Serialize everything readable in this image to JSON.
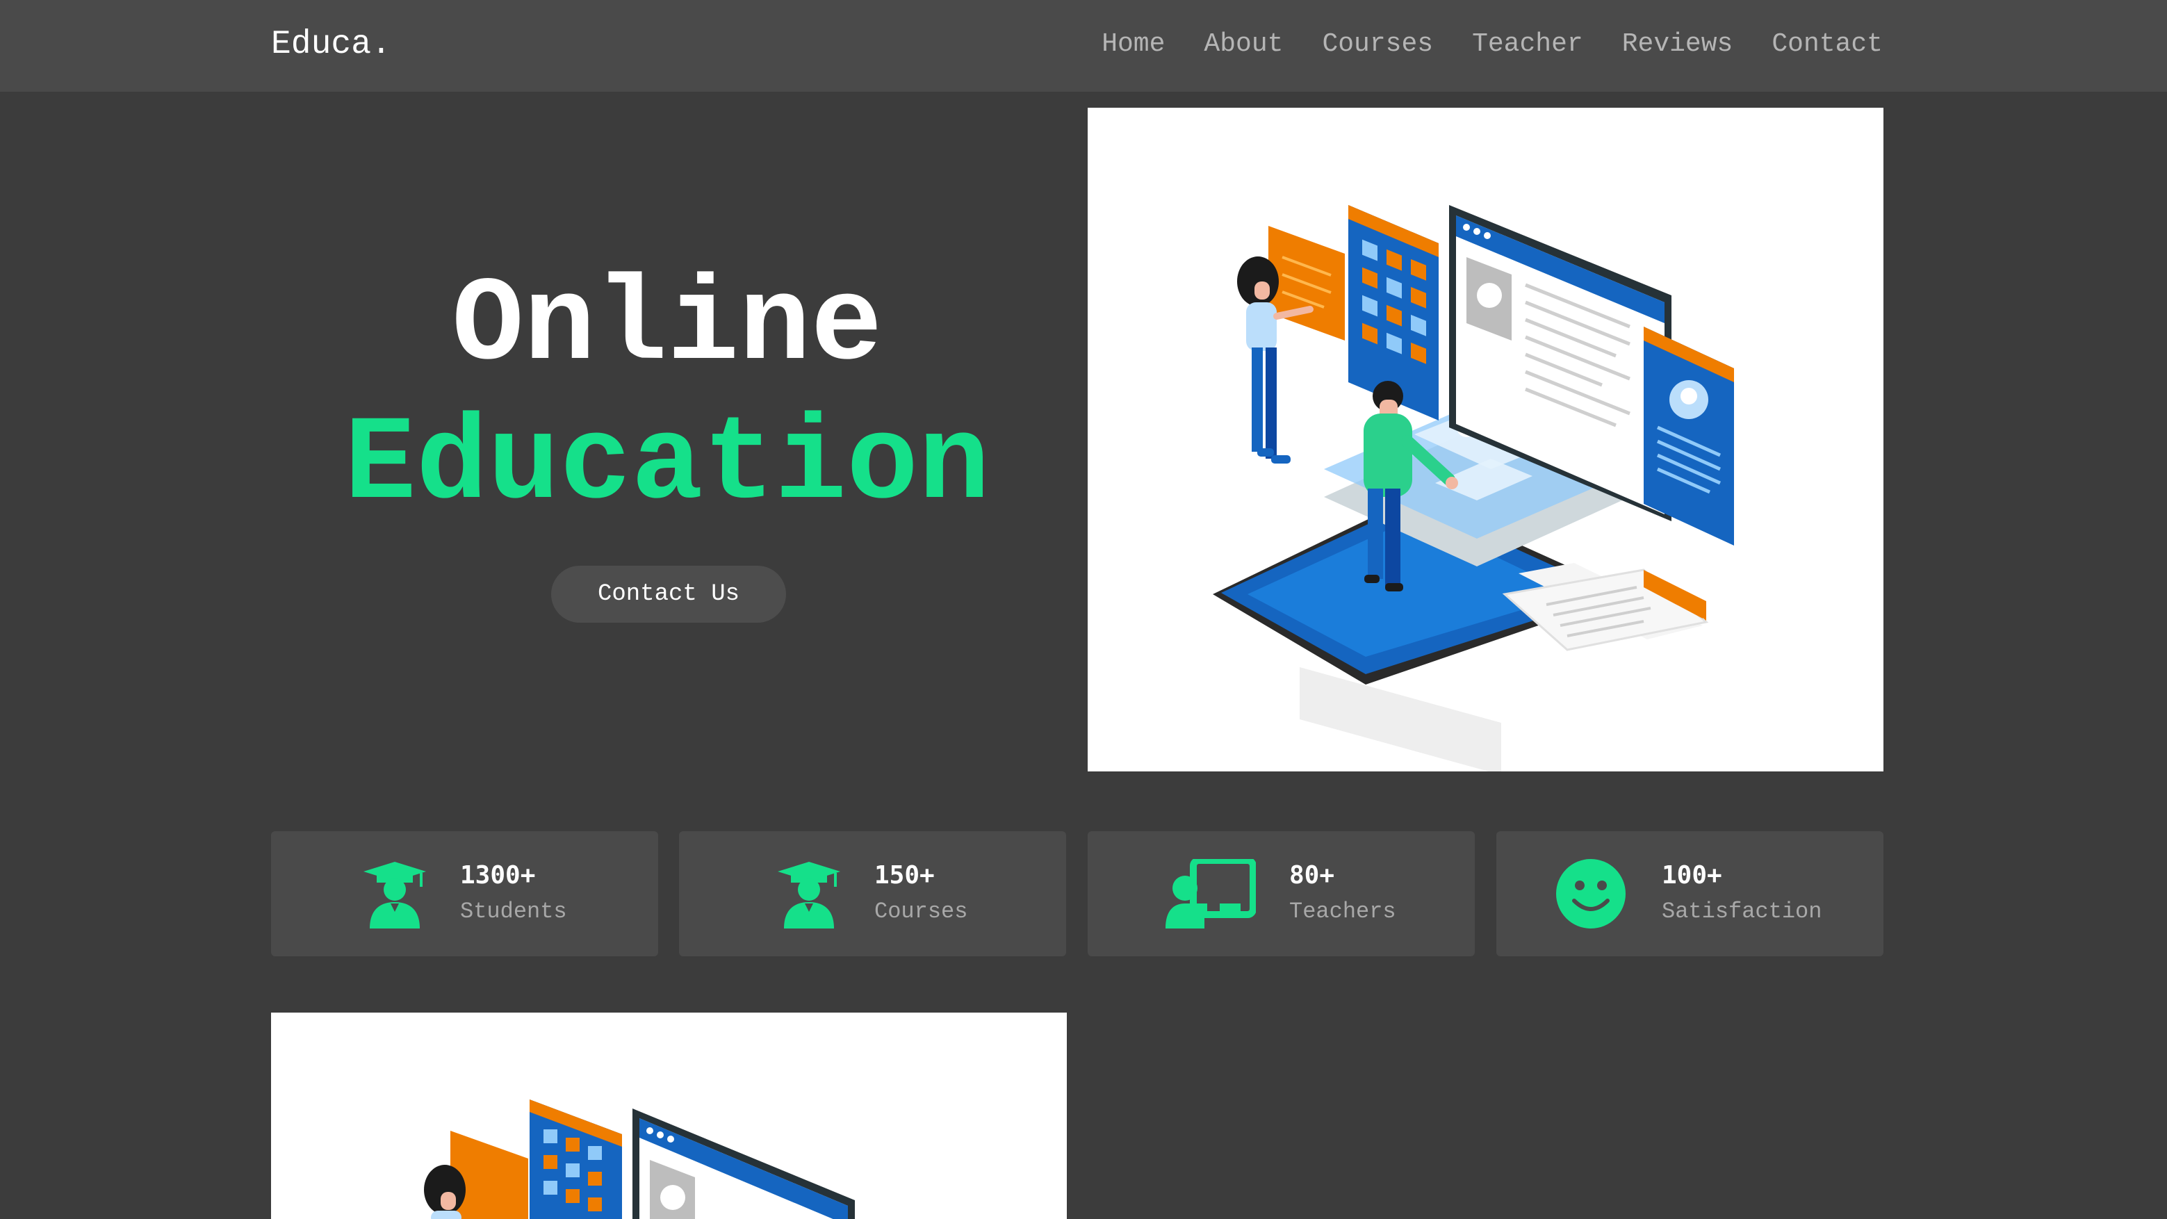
{
  "nav": {
    "logo": "Educa.",
    "links": [
      "Home",
      "About",
      "Courses",
      "Teacher",
      "Reviews",
      "Contact"
    ]
  },
  "hero": {
    "line1": "Online",
    "line2": "Education",
    "button": "Contact Us"
  },
  "stats": [
    {
      "value": "1300+",
      "label": "Students",
      "icon": "graduate-icon"
    },
    {
      "value": "150+",
      "label": "Courses",
      "icon": "graduate-icon"
    },
    {
      "value": "80+",
      "label": "Teachers",
      "icon": "teacher-icon"
    },
    {
      "value": "100+",
      "label": "Satisfaction",
      "icon": "smile-icon"
    }
  ],
  "colors": {
    "background": "#3c3c3c",
    "navbar": "#4a4a4a",
    "card": "#4a4a4a",
    "accent": "#15e08a",
    "text": "#ffffff",
    "muted": "#a8a8a8"
  }
}
